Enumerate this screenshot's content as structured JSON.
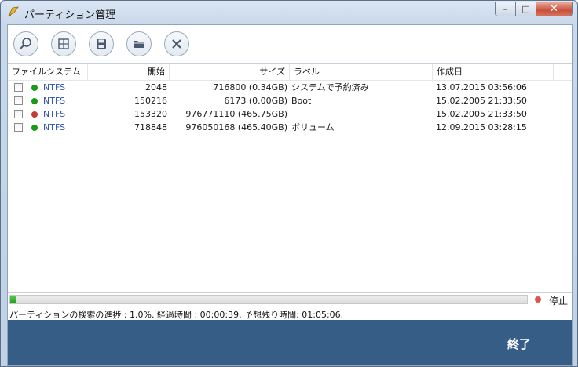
{
  "window": {
    "title": "パーティション管理",
    "controls": {
      "minimize": "–",
      "maximize": "□",
      "close": "✕"
    }
  },
  "toolbar": {
    "buttons": [
      {
        "name": "search-button",
        "icon": "magnifier-icon"
      },
      {
        "name": "partition-view-button",
        "icon": "grid-icon"
      },
      {
        "name": "save-button",
        "icon": "floppy-disk-icon"
      },
      {
        "name": "open-button",
        "icon": "folder-icon"
      },
      {
        "name": "cancel-button",
        "icon": "close-x-icon"
      }
    ]
  },
  "list": {
    "columns": [
      "ファイルシステム",
      "開始",
      "サイズ",
      "ラベル",
      "作成日"
    ],
    "rows": [
      {
        "status_color": "#1a9a1a",
        "fs": "NTFS",
        "start": "2048",
        "size": "716800 (0.34GB)",
        "label": "システムで予約済み",
        "created": "13.07.2015 03:56:06"
      },
      {
        "status_color": "#1a9a1a",
        "fs": "NTFS",
        "start": "150216",
        "size": "6173 (0.00GB)",
        "label": "Boot",
        "created": "15.02.2005 21:33:50"
      },
      {
        "status_color": "#c23a3a",
        "fs": "NTFS",
        "start": "153320",
        "size": "976771110 (465.75GB)",
        "label": "",
        "created": "15.02.2005 21:33:50"
      },
      {
        "status_color": "#1a9a1a",
        "fs": "NTFS",
        "start": "718848",
        "size": "976050168 (465.40GB)",
        "label": "ボリューム",
        "created": "12.09.2015 03:28:15"
      }
    ]
  },
  "progress": {
    "percent": 1.0,
    "stop_label": "停止",
    "stop_color": "#d9534f"
  },
  "status_text": "パーティションの検索の進捗 : 1.0%. 経過時間 : 00:00:39. 予想残り時間: 01:05:06.",
  "footer": {
    "finish_label": "終了"
  }
}
